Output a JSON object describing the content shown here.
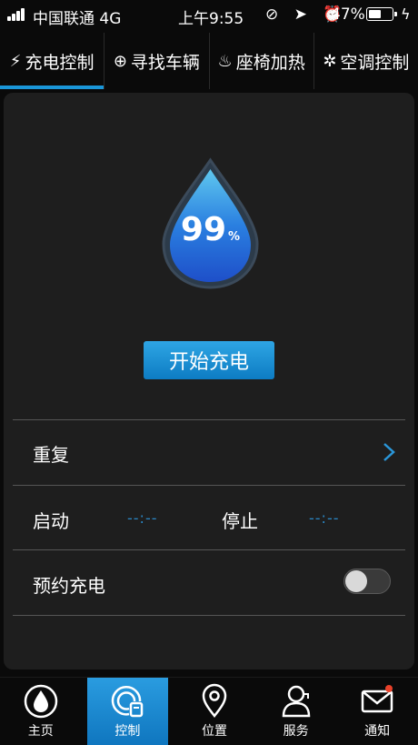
{
  "status_bar": {
    "carrier": "中国联通  4G",
    "time": "上午9:55",
    "icons": "⊘ ➤ ⏰",
    "battery_percent": "47%",
    "battery_level": 0.47
  },
  "tabs": [
    {
      "icon": "⚡",
      "label": "充电控制",
      "active": true
    },
    {
      "icon": "⊕",
      "label": "寻找车辆",
      "active": false
    },
    {
      "icon": "♨",
      "label": "座椅加热",
      "active": false
    },
    {
      "icon": "✲",
      "label": "空调控制",
      "active": false
    }
  ],
  "charge": {
    "percent": "99",
    "unit": "%",
    "level": 0.99,
    "button": "开始充电"
  },
  "schedule": {
    "repeat_label": "重复",
    "start_label": "启动",
    "start_time": "--:--",
    "stop_label": "停止",
    "stop_time": "--:--",
    "reserve_label": "预约充电",
    "reserve_on": false
  },
  "bottom_nav": [
    {
      "icon": "home-icon",
      "label": "主页",
      "active": false
    },
    {
      "icon": "control-icon",
      "label": "控制",
      "active": true
    },
    {
      "icon": "location-icon",
      "label": "位置",
      "active": false
    },
    {
      "icon": "service-icon",
      "label": "服务",
      "active": false
    },
    {
      "icon": "mail-icon",
      "label": "通知",
      "active": false,
      "badge": true
    }
  ],
  "colors": {
    "accent": "#1a96d8",
    "time_value": "#2a86c4",
    "badge": "#e8412a"
  }
}
